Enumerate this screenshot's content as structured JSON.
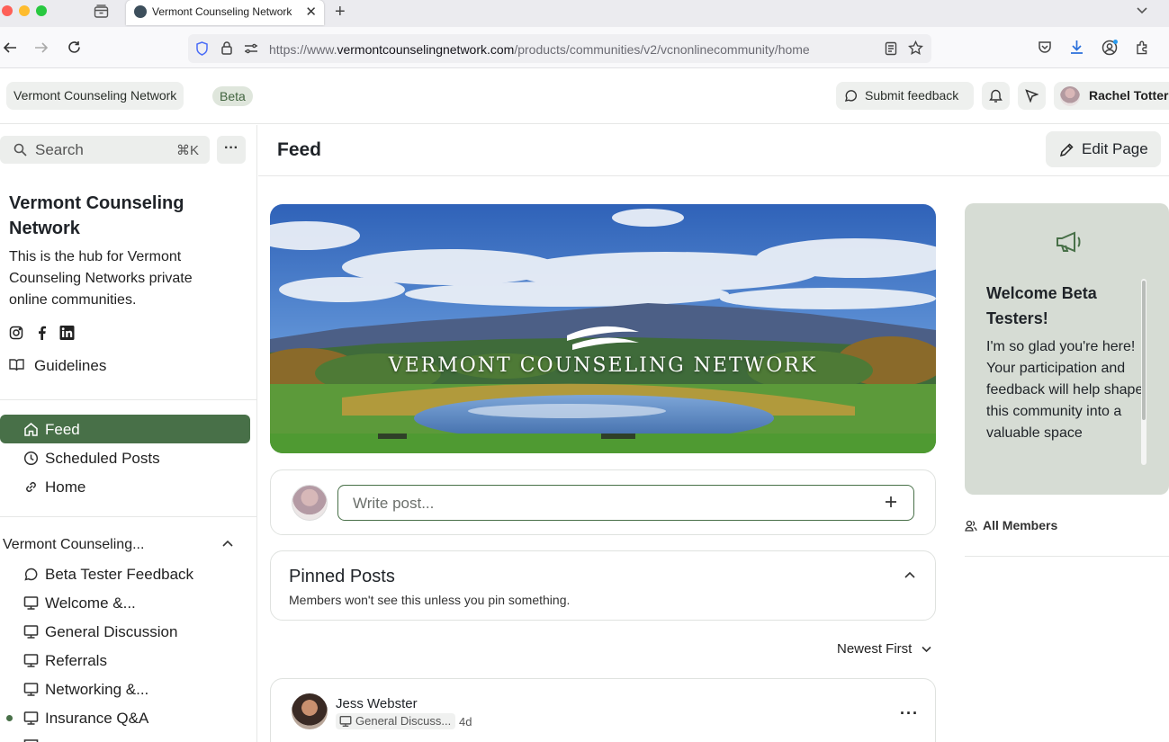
{
  "browser": {
    "tab_title": "Vermont Counseling Network",
    "url_prefix": "https://www.",
    "url_domain": "vermontcounselingnetwork.com",
    "url_path": "/products/communities/v2/vcnonlinecommunity/home"
  },
  "header": {
    "brand": "Vermont Counseling Network",
    "beta_badge": "Beta",
    "feedback_label": "Submit feedback",
    "user_name": "Rachel Totter"
  },
  "sidebar": {
    "search_placeholder": "Search",
    "search_shortcut": "⌘K",
    "community_title": "Vermont Counseling Network",
    "community_desc": "This is the hub for Vermont Counseling Networks private online communities.",
    "guidelines_label": "Guidelines",
    "nav": [
      {
        "label": "Feed",
        "icon": "home-icon"
      },
      {
        "label": "Scheduled Posts",
        "icon": "clock-icon"
      },
      {
        "label": "Home",
        "icon": "link-icon"
      }
    ],
    "group_title": "Vermont Counseling...",
    "channels": [
      {
        "label": "Beta Tester Feedback",
        "icon": "chat-bubble-icon"
      },
      {
        "label": "Welcome &...",
        "icon": "monitor-icon"
      },
      {
        "label": "General Discussion",
        "icon": "monitor-icon"
      },
      {
        "label": "Referrals",
        "icon": "monitor-icon"
      },
      {
        "label": "Networking &...",
        "icon": "monitor-icon"
      },
      {
        "label": "Insurance Q&A",
        "icon": "monitor-icon"
      }
    ]
  },
  "main": {
    "page_title": "Feed",
    "edit_label": "Edit Page",
    "banner_text": "VERMONT COUNSELING NETWORK",
    "write_placeholder": "Write post...",
    "pinned_title": "Pinned Posts",
    "pinned_subtitle": "Members won't see this unless you pin something.",
    "sort_label": "Newest First",
    "post": {
      "author": "Jess Webster",
      "channel": "General Discuss...",
      "time": "4d"
    }
  },
  "right": {
    "welcome_title": "Welcome Beta Testers!",
    "welcome_body": "I'm so glad you're here! Your participation and feedback will help shape this community into a valuable space",
    "members_label": "All Members"
  },
  "colors": {
    "accent": "#487048",
    "accent_light": "#dfe6dc",
    "panel": "#d6dcd4"
  }
}
